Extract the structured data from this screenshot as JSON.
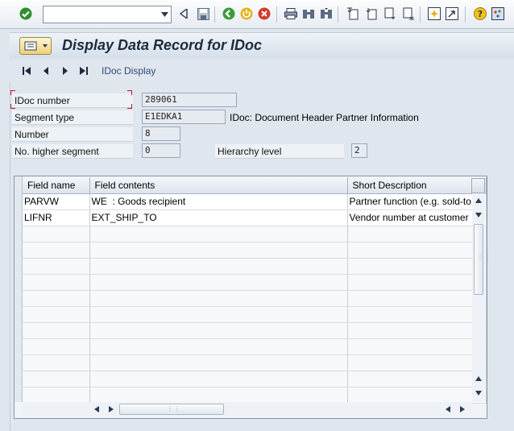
{
  "toolbar": {
    "command_field": {
      "value": "",
      "placeholder": ""
    },
    "icons": [
      "enter-icon",
      "command-dropdown-icon",
      "back-arrow-icon",
      "save-icon",
      "back-icon",
      "exit-icon",
      "cancel-icon",
      "print-icon",
      "find-icon",
      "find-next-icon",
      "first-page-icon",
      "previous-page-icon",
      "next-page-icon",
      "last-page-icon",
      "create-session-icon",
      "shortcut-icon",
      "help-icon",
      "customize-layout-icon"
    ]
  },
  "screen": {
    "title": "Display Data Record for IDoc"
  },
  "app_toolbar": {
    "idoc_display_label": "IDoc Display"
  },
  "fields": {
    "idoc_number": {
      "label": "IDoc number",
      "value": "289061"
    },
    "segment_type": {
      "label": "Segment type",
      "value": "E1EDKA1",
      "description": "IDoc: Document Header Partner Information"
    },
    "number": {
      "label": "Number",
      "value": "8"
    },
    "higher_segment": {
      "label": "No. higher segment",
      "value": "0"
    },
    "hierarchy_level": {
      "label": "Hierarchy level",
      "value": "2"
    }
  },
  "table": {
    "columns": [
      "Field name",
      "Field contents",
      "Short Description"
    ],
    "rows": [
      [
        "PARVW",
        "WE  : Goods recipient",
        "Partner function (e.g. sold-to"
      ],
      [
        "LIFNR",
        "EXT_SHIP_TO",
        "Vendor number at customer"
      ]
    ],
    "empty_rows": 11
  },
  "colors": {
    "background": "#dfe6ee",
    "title_text": "#1d2b3c",
    "focus_marker": "#c8102e"
  }
}
